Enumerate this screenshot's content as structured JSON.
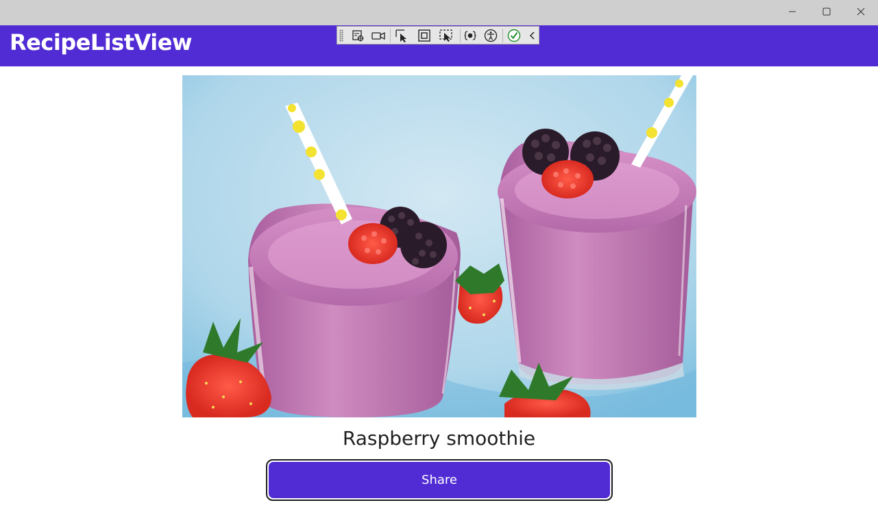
{
  "window": {
    "controls": {
      "minimize_icon": "minimize-icon",
      "maximize_icon": "maximize-icon",
      "close_icon": "close-icon"
    }
  },
  "header": {
    "title": "RecipeListView",
    "background": "#512bd4"
  },
  "debug_toolbar": {
    "tools": [
      {
        "icon": "live-visual-tree-icon"
      },
      {
        "icon": "record-icon"
      },
      {
        "icon": "select-element-icon"
      },
      {
        "icon": "display-layout-adorners-icon"
      },
      {
        "icon": "track-focused-element-icon"
      },
      {
        "icon": "binding-failures-icon"
      },
      {
        "icon": "accessibility-checker-icon"
      },
      {
        "icon": "hot-reload-status-icon"
      },
      {
        "icon": "collapse-toolbar-icon"
      }
    ]
  },
  "content": {
    "image_alt": "smoothie-photo",
    "recipe_title": "Raspberry smoothie",
    "share_label": "Share",
    "accent": "#512bd4"
  }
}
